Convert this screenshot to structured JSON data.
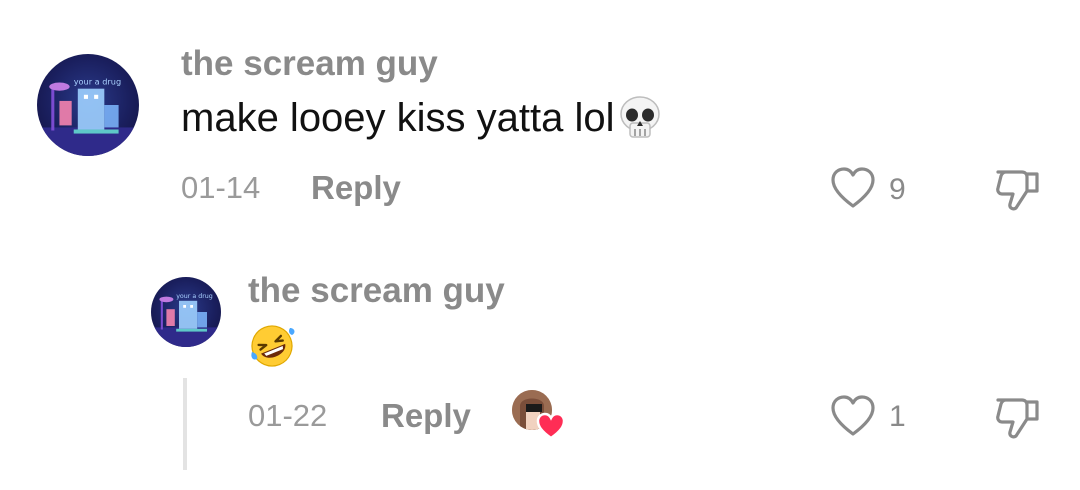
{
  "comments": [
    {
      "username": "the scream guy",
      "avatar_caption": "your a drug",
      "text": "make looey kiss yatta lol",
      "emoji": "skull",
      "date": "01-14",
      "reply_label": "Reply",
      "likes": "9"
    },
    {
      "username": "the scream guy",
      "avatar_caption": "your a drug",
      "text": "",
      "emoji": "rolling-on-floor-laughing",
      "date": "01-22",
      "reply_label": "Reply",
      "likes": "1",
      "creator_liked": true
    }
  ],
  "colors": {
    "username": "#8a8a8a",
    "text": "#111111",
    "meta": "#9a9a9a",
    "heart": "#ff2d55"
  }
}
